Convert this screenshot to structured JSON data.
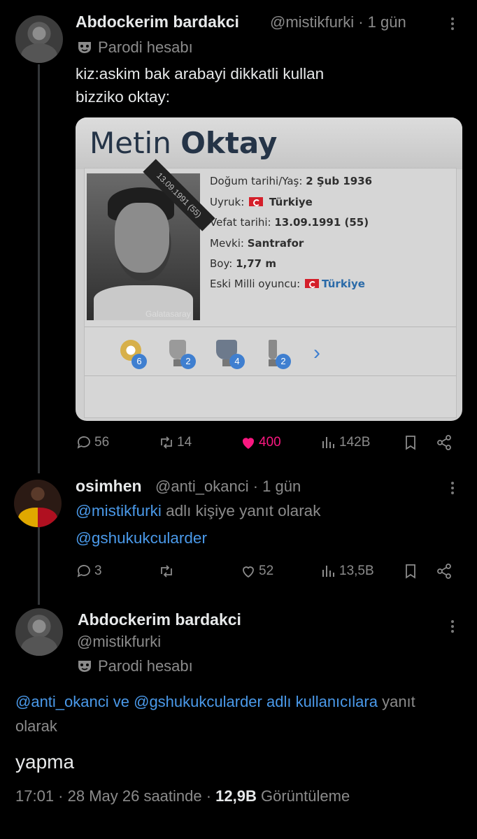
{
  "tweet1": {
    "name": "Abdockerim bardakci",
    "meta": "@mistikfurki · 1 gün",
    "parody": "Parodi hesabı",
    "text_line1": "kiz:askim bak arabayi dikkatli kullan",
    "text_line2": "bizziko oktay:",
    "card": {
      "first_name": "Metin ",
      "last_name": "Oktay",
      "photo_ribbon": "13.09.1991 (55)",
      "photo_club": "Galatasaray",
      "rows": [
        {
          "label": "Doğum tarihi/Yaş:",
          "value": "2 Şub 1936"
        },
        {
          "label": "Uyruk:",
          "value": "Türkiye"
        },
        {
          "label": "Vefat tarihi:",
          "value": "13.09.1991 (55)"
        },
        {
          "label": "Mevki:",
          "value": "Santrafor"
        },
        {
          "label": "Boy:",
          "value": "1,77 m"
        },
        {
          "label": "Eski Milli oyuncu:",
          "value": "Türkiye"
        }
      ],
      "trophies": [
        "6",
        "2",
        "4",
        "2"
      ]
    },
    "actions": {
      "replies": "56",
      "retweets": "14",
      "likes": "400",
      "views": "142B"
    }
  },
  "tweet2": {
    "name": "osimhen",
    "meta": "@anti_okanci · 1 gün",
    "mention1": "@mistikfurki",
    "reply_text": " adlı kişiye yanıt olarak",
    "mention2": "@gshukukcularder",
    "actions": {
      "replies": "3",
      "retweets": "",
      "likes": "52",
      "views": "13,5B"
    }
  },
  "tweet3": {
    "name": "Abdockerim bardakci",
    "handle": "@mistikfurki",
    "parody": "Parodi hesabı",
    "mention1": "@anti_okanci",
    "joiner": " ve ",
    "mention2": "@gshukukcularder",
    "reply_tail_blue": " adlı kullanıcılara",
    "reply_tail": " yanıt",
    "reply_line2": "olarak",
    "text": "yapma",
    "time": "17:01 · 28 May 26 saatinde · ",
    "views_count": "12,9B",
    "views_label": " Görüntüleme"
  },
  "colors": {
    "accent": "#4a99e9",
    "like": "#f91880",
    "background": "#000000"
  }
}
